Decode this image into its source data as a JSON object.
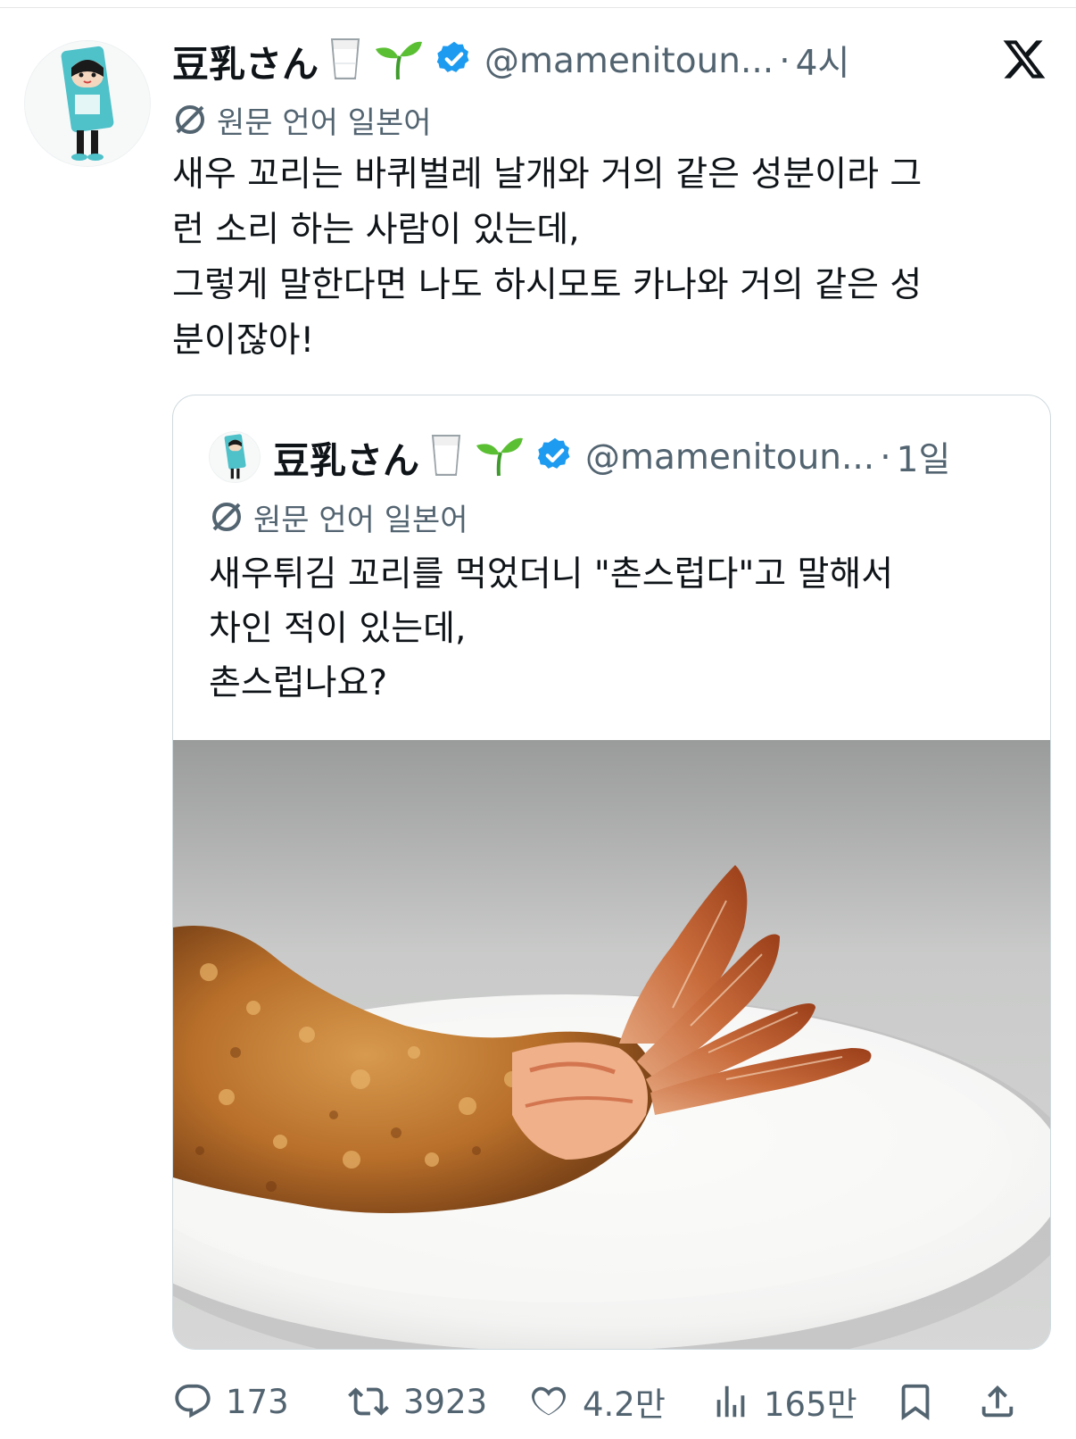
{
  "tweet": {
    "display_name": "豆乳さん",
    "handle": "@mamenitoun...",
    "separator": "·",
    "time": "4시",
    "translate_label": "원문 언어 일본어",
    "body": "새우 꼬리는 바퀴벌레 날개와 거의 같은 성분이라 그\n런 소리 하는 사람이 있는데,\n그렇게 말한다면 나도 하시모토 카나와 거의 같은 성\n분이잖아!",
    "emojis": [
      "milk-glass",
      "seedling",
      "verified-badge"
    ]
  },
  "quote": {
    "display_name": "豆乳さん",
    "handle": "@mamenitoun...",
    "separator": "·",
    "time": "1일",
    "translate_label": "원문 언어 일본어",
    "body": "새우튀김 꼬리를 먹었더니 \"촌스럽다\"고 말해서\n차인 적이 있는데,\n촌스럽나요?",
    "media": "fried shrimp tempura on white plate"
  },
  "actions": {
    "replies": "173",
    "reposts": "3923",
    "likes": "4.2만",
    "views": "165만"
  },
  "colors": {
    "text": "#0f1419",
    "secondary": "#536471",
    "verified": "#1d9bf0",
    "border": "#cfd9de"
  }
}
